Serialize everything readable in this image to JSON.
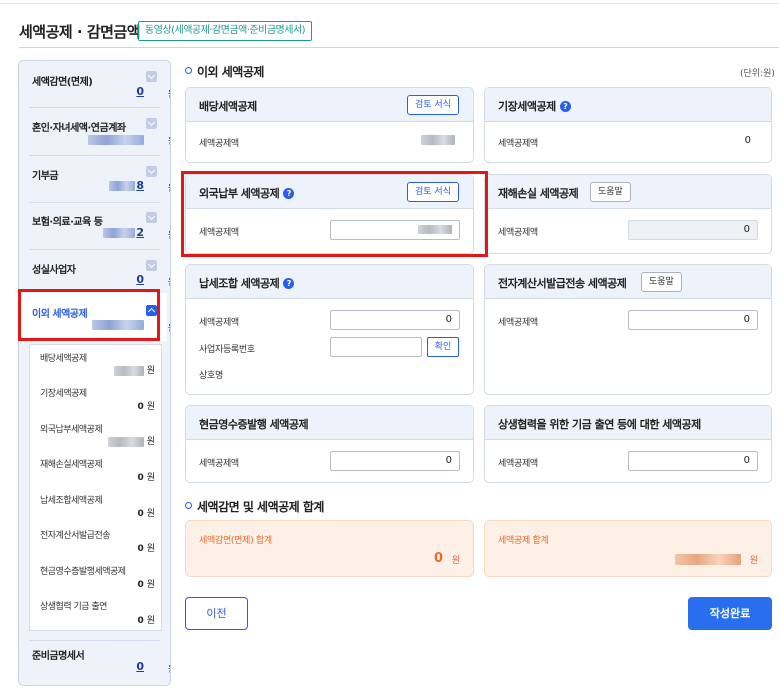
{
  "page": {
    "title": "세액공제 · 감면금액",
    "video_button": "동영상(세액공제·감면금액·준비금명세서)"
  },
  "sidebar": {
    "items": [
      {
        "label": "세액감면(면제)",
        "value": "0",
        "unit": "원"
      },
      {
        "label": "혼인·자녀세액·연금계좌",
        "value": "",
        "unit": "원"
      },
      {
        "label": "기부금",
        "value": "8",
        "unit": "원"
      },
      {
        "label": "보험·의료·교육 등",
        "value": "2",
        "unit": "원"
      },
      {
        "label": "성실사업자",
        "value": "0",
        "unit": "원"
      },
      {
        "label": "이외 세액공제",
        "value": "",
        "unit": "원"
      },
      {
        "label": "준비금명세서",
        "value": "0",
        "unit": "원"
      }
    ],
    "sub_items": [
      {
        "label": "배당세액공제",
        "value": "",
        "unit": "원"
      },
      {
        "label": "기장세액공제",
        "value": "0",
        "unit": "원"
      },
      {
        "label": "외국납부세액공제",
        "value": "",
        "unit": "원"
      },
      {
        "label": "재해손실세액공제",
        "value": "0",
        "unit": "원"
      },
      {
        "label": "납세조합세액공제",
        "value": "0",
        "unit": "원"
      },
      {
        "label": "전자계산서발급전송",
        "value": "0",
        "unit": "원"
      },
      {
        "label": "현금영수증발행세액공제",
        "value": "0",
        "unit": "원"
      },
      {
        "label": "상생협력 기금 출연",
        "value": "0",
        "unit": "원"
      }
    ]
  },
  "main": {
    "section1_title": "이외 세액공제",
    "unit_note": "(단위:원)",
    "cards": {
      "dividend": {
        "title": "배당세액공제",
        "button": "검토 서식",
        "field_label": "세액공제액",
        "value": ""
      },
      "bookkeeping": {
        "title": "기장세액공제",
        "help": "?",
        "field_label": "세액공제액",
        "value": "0"
      },
      "foreign": {
        "title": "외국납부 세액공제",
        "help": "?",
        "button": "검토 서식",
        "field_label": "세액공제액",
        "value": ""
      },
      "disaster": {
        "title": "재해손실 세액공제",
        "button": "도움말",
        "field_label": "세액공제액",
        "value": "0"
      },
      "union": {
        "title": "납세조합 세액공제",
        "help": "?",
        "field_label": "세액공제액",
        "value": "0",
        "bizno_label": "사업자등록번호",
        "bizno_value": "",
        "confirm": "확인",
        "company_label": "상호명"
      },
      "einvoice": {
        "title": "전자계산서발급전송 세액공제",
        "button": "도움말",
        "field_label": "세액공제액",
        "value": "0"
      },
      "cashreceipt": {
        "title": "현금영수증발행 세액공제",
        "field_label": "세액공제액",
        "value": "0"
      },
      "cooperation": {
        "title": "상생협력을 위한 기금 출연 등에 대한 세액공제",
        "field_label": "세액공제액",
        "value": "0"
      }
    },
    "section2_title": "세액감면 및 세액공제 합계",
    "totals": {
      "reduction_label": "세액감면(면제) 합계",
      "reduction_value": "0",
      "credit_label": "세액공제 합계",
      "credit_value": "",
      "unit": "원"
    }
  },
  "footer": {
    "prev": "이전",
    "done": "작성완료"
  },
  "colors": {
    "accent": "#2a5ee8",
    "highlight": "#e01818",
    "total": "#e86a2a"
  }
}
